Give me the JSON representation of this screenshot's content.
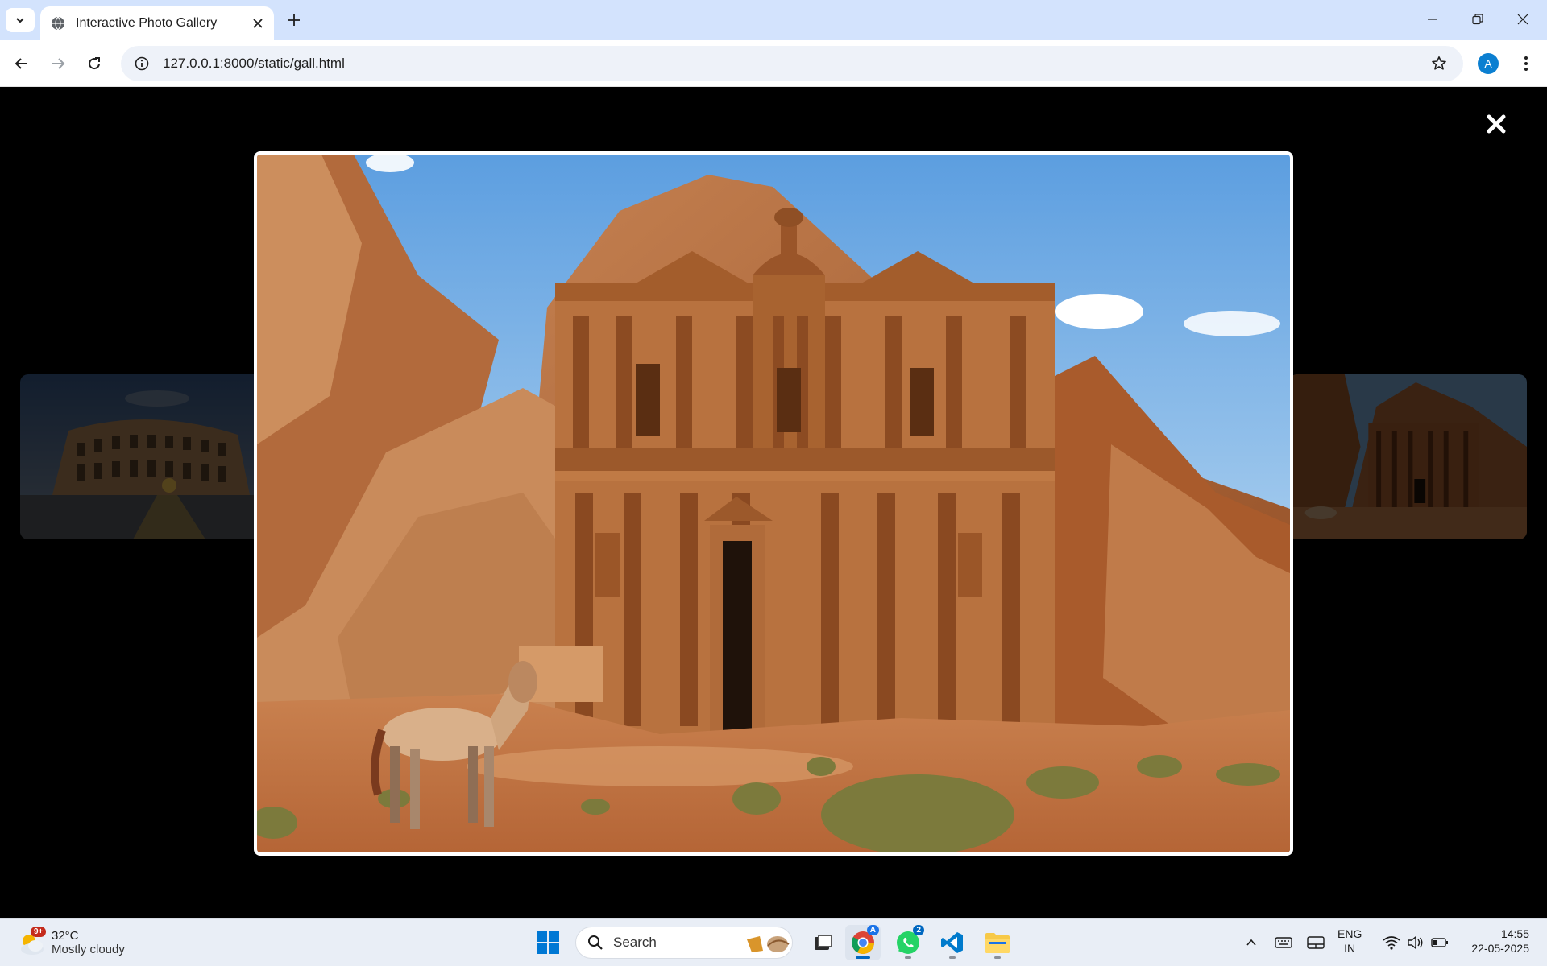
{
  "browser": {
    "tab": {
      "title": "Interactive Photo Gallery"
    },
    "address": {
      "url": "127.0.0.1:8000/static/gall.html"
    },
    "profile_initial": "A"
  },
  "gallery": {
    "lightbox": {
      "close_icon": "close-icon",
      "current_image": "petra-monastery",
      "prev_image": "colosseum",
      "next_image": "petra-monastery"
    }
  },
  "taskbar": {
    "weather": {
      "temp": "32°C",
      "condition": "Mostly cloudy",
      "badge": "9+"
    },
    "search": {
      "placeholder": "Search"
    },
    "whatsapp_badge": "2",
    "language": {
      "line1": "ENG",
      "line2": "IN"
    },
    "clock": {
      "time": "14:55",
      "date": "22-05-2025"
    }
  },
  "colors": {
    "tabstrip": "#d3e3fd",
    "omnibox": "#eef2f9",
    "page_background": "#000000",
    "taskbar": "#e9eef6",
    "accent": "#0067c0"
  }
}
